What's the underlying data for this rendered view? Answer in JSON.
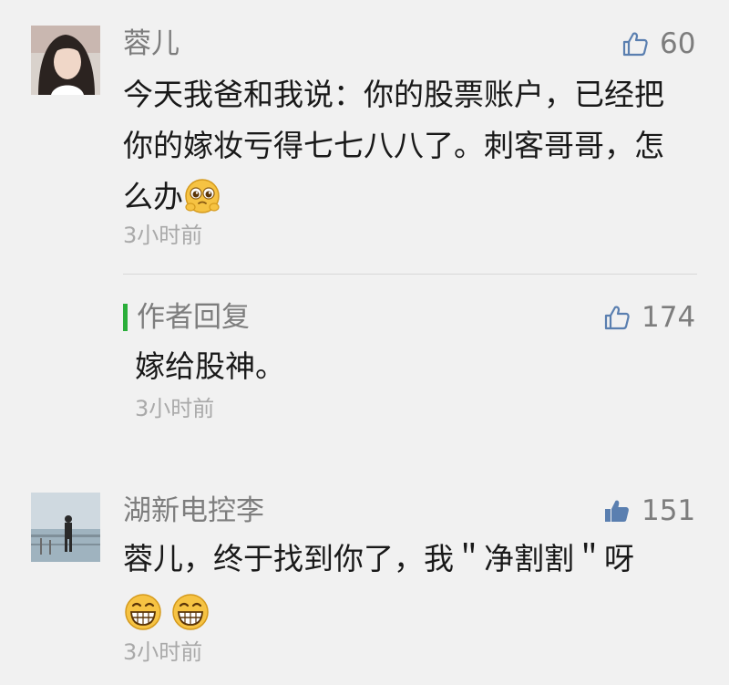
{
  "comments": [
    {
      "name": "蓉儿",
      "likes": "60",
      "text": "今天我爸和我说：你的股票账户，已经把你的嫁妆亏得七七八八了。刺客哥哥，怎么办",
      "time": "3小时前",
      "reply": {
        "label": "作者回复",
        "likes": "174",
        "text": "嫁给股神。",
        "time": "3小时前"
      }
    },
    {
      "name": "湖新电控李",
      "likes": "151",
      "text": "蓉儿，终于找到你了，我＂净割割＂呀",
      "time": "3小时前"
    }
  ],
  "icons": {
    "like_outline": "thumbs-up-outline",
    "like_filled": "thumbs-up-filled",
    "emoji_worried": "pleading-face-emoji",
    "emoji_grin": "grinning-face-emoji"
  },
  "colors": {
    "background": "#f1f1f1",
    "reply_accent": "#2aae3a",
    "like_filled": "#5a7fb0"
  }
}
